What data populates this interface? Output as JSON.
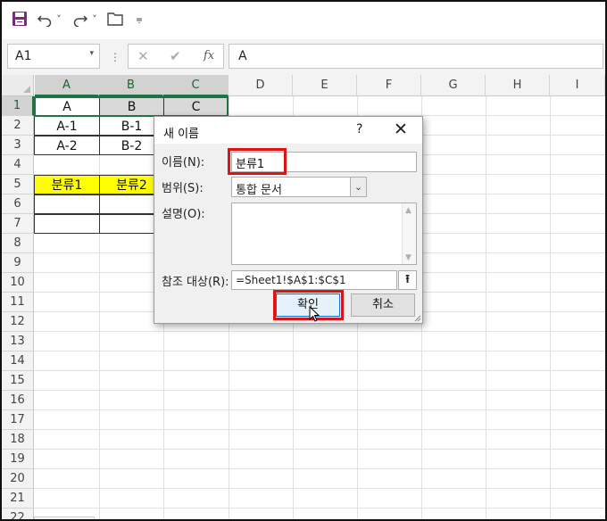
{
  "qat": {
    "icons": [
      "save-icon",
      "undo-icon",
      "redo-icon",
      "open-icon",
      "customize-icon"
    ],
    "undo_caret": "˅",
    "redo_caret": "˅",
    "customize_glyph": "⩦"
  },
  "formula_bar": {
    "name_box": "A1",
    "name_box_caret": "▾",
    "separator": "⋮",
    "cancel_glyph": "✕",
    "enter_glyph": "✔",
    "fx_label": "fx",
    "content": "A"
  },
  "grid": {
    "columns": [
      "A",
      "B",
      "C",
      "D",
      "E",
      "F",
      "G",
      "H",
      "I"
    ],
    "rows": [
      "1",
      "2",
      "3",
      "4",
      "5",
      "6",
      "7",
      "8",
      "9",
      "10",
      "11",
      "12",
      "13",
      "14",
      "15",
      "16",
      "17",
      "18",
      "19",
      "20",
      "21",
      "22"
    ],
    "cells": {
      "A1": "A",
      "B1": "B",
      "C1": "C",
      "A2": "A-1",
      "B2": "B-1",
      "A3": "A-2",
      "B3": "B-2",
      "A5": "분류1",
      "B5": "분류2"
    },
    "fill_colors": {
      "yellow": "#ffff00",
      "selection_border": "#217346"
    }
  },
  "dialog": {
    "title": "새 이름",
    "help": "?",
    "close": "✕",
    "name_label": "이름(N):",
    "name_value": "분류1",
    "scope_label": "범위(S):",
    "scope_value": "통합 문서",
    "scope_caret": "⌄",
    "comment_label": "설명(O):",
    "comment_value": "",
    "scroll_up": "▲",
    "scroll_down": "▼",
    "refers_label": "참조 대상(R):",
    "refers_value": "=Sheet1!$A$1:$C$1",
    "refers_button": "⭱",
    "ok_button": "확인",
    "cancel_button": "취소",
    "highlight_color": "#e01212"
  }
}
